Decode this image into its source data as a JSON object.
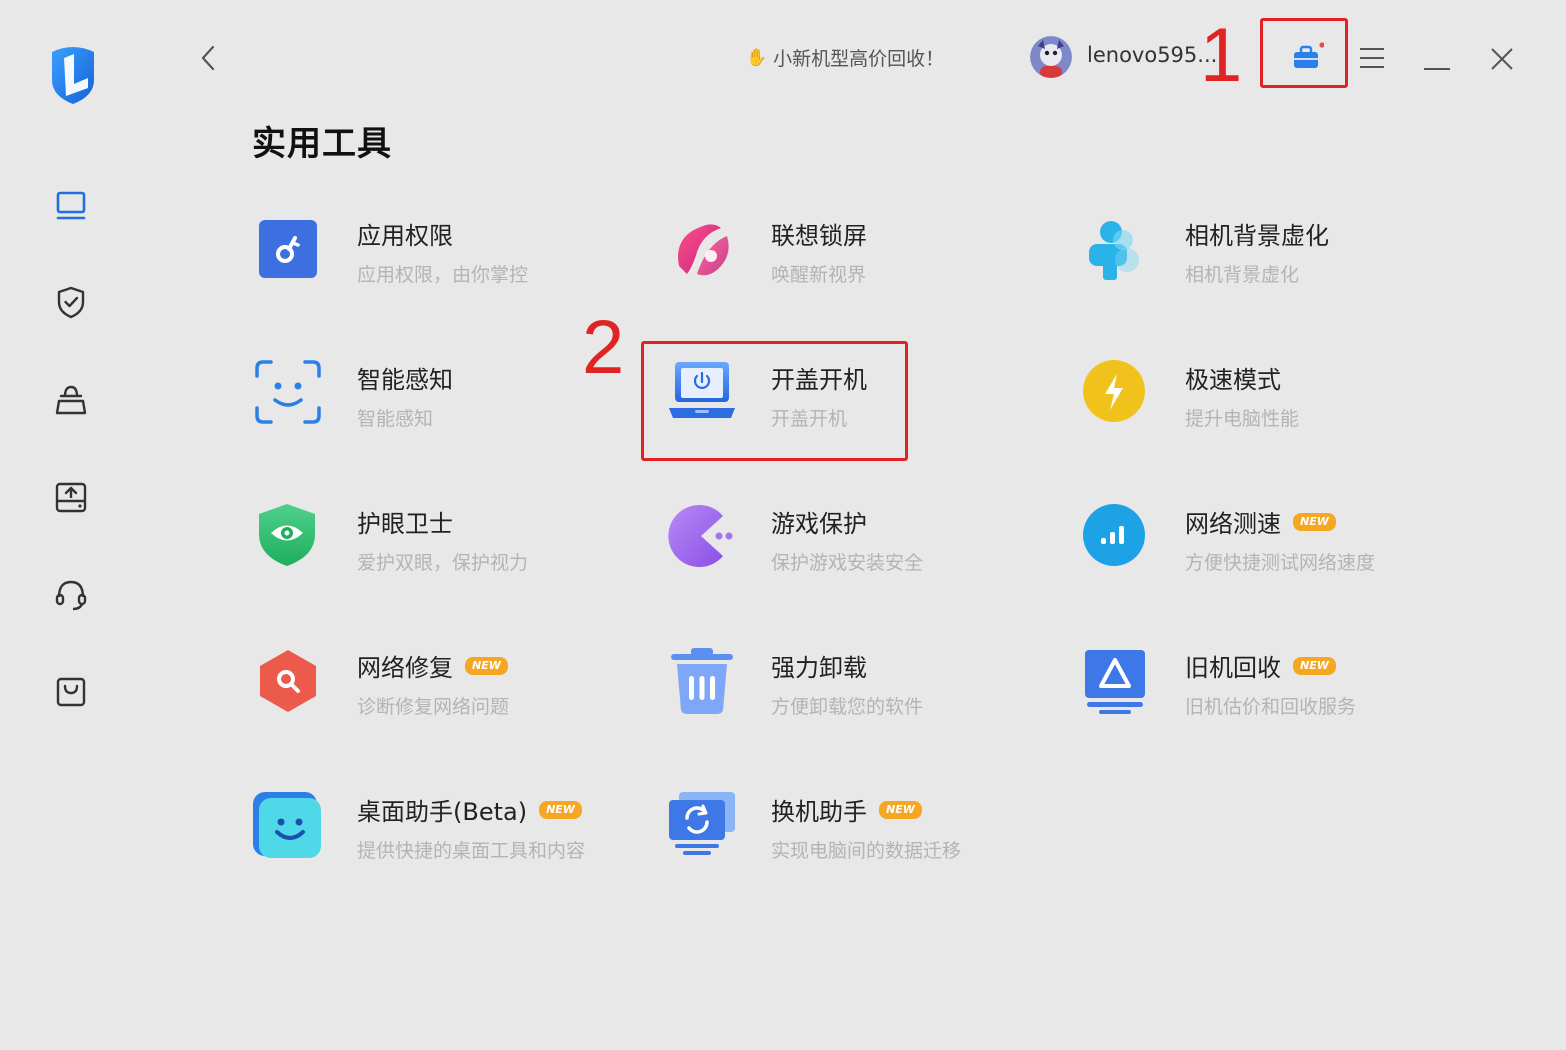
{
  "colors": {
    "accent": "#2b7fe8",
    "annotation_red": "#e02424",
    "background": "#e8e8e8",
    "badge_new": "#f5a623"
  },
  "topbar": {
    "promo_text": "小新机型高价回收！",
    "username": "lenovo595...",
    "icons": [
      "back-icon",
      "toolbox-icon",
      "menu-icon",
      "minimize-icon",
      "close-icon"
    ]
  },
  "annotations": {
    "marker_1": "1",
    "marker_2": "2"
  },
  "sidebar": {
    "items": [
      {
        "icon": "laptop-icon"
      },
      {
        "icon": "shield-check-icon"
      },
      {
        "icon": "shopping-bag-icon"
      },
      {
        "icon": "upload-tray-icon"
      },
      {
        "icon": "headset-icon"
      },
      {
        "icon": "store-bag-icon"
      }
    ]
  },
  "page_title": "实用工具",
  "tools": [
    {
      "name": "应用权限",
      "desc": "应用权限，由你掌控",
      "new": "",
      "icon": "key-icon"
    },
    {
      "name": "联想锁屏",
      "desc": "唤醒新视界",
      "new": "",
      "icon": "lockscreen-icon"
    },
    {
      "name": "相机背景虚化",
      "desc": "相机背景虚化",
      "new": "",
      "icon": "person-blur-icon"
    },
    {
      "name": "智能感知",
      "desc": "智能感知",
      "new": "",
      "icon": "face-scan-icon"
    },
    {
      "name": "开盖开机",
      "desc": "开盖开机",
      "new": "",
      "icon": "laptop-power-icon"
    },
    {
      "name": "极速模式",
      "desc": "提升电脑性能",
      "new": "",
      "icon": "lightning-icon"
    },
    {
      "name": "护眼卫士",
      "desc": "爱护双眼，保护视力",
      "new": "",
      "icon": "eye-shield-icon"
    },
    {
      "name": "游戏保护",
      "desc": "保护游戏安装安全",
      "new": "",
      "icon": "pacman-icon"
    },
    {
      "name": "网络测速",
      "desc": "方便快捷测试网络速度",
      "new": "NEW",
      "icon": "signal-bars-icon"
    },
    {
      "name": "网络修复",
      "desc": "诊断修复网络问题",
      "new": "NEW",
      "icon": "network-repair-icon"
    },
    {
      "name": "强力卸载",
      "desc": "方便卸载您的软件",
      "new": "",
      "icon": "trash-icon"
    },
    {
      "name": "旧机回收",
      "desc": "旧机估价和回收服务",
      "new": "NEW",
      "icon": "recycle-icon"
    },
    {
      "name": "桌面助手(Beta)",
      "desc": "提供快捷的桌面工具和内容",
      "new": "NEW",
      "icon": "smile-icon"
    },
    {
      "name": "换机助手",
      "desc": "实现电脑间的数据迁移",
      "new": "NEW",
      "icon": "transfer-icon"
    }
  ]
}
